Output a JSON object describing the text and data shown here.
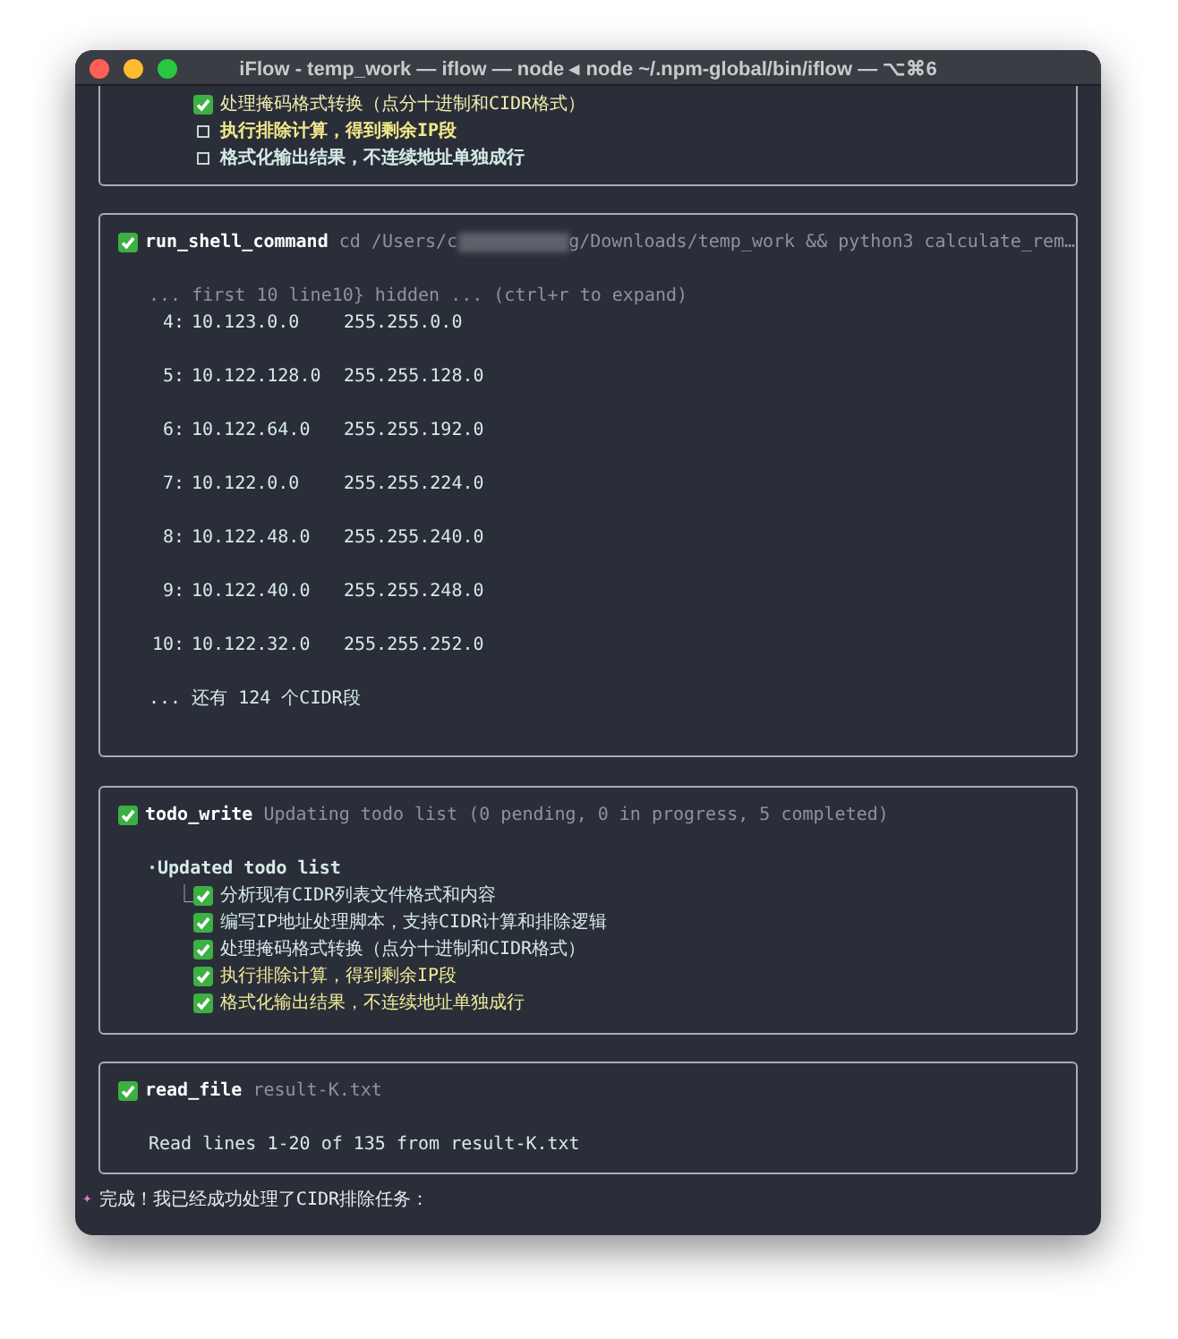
{
  "window": {
    "title": "iFlow - temp_work — iflow — node ◂ node ~/.npm-global/bin/iflow — ⌥⌘6"
  },
  "top_todo": {
    "items": [
      {
        "text": "处理掩码格式转换（点分十进制和CIDR格式）",
        "checked": true,
        "color": "#f3eeae"
      },
      {
        "text": "执行排除计算，得到剩余IP段",
        "checked": false,
        "color": "#f2e889"
      },
      {
        "text": "格式化输出结果，不连续地址单独成行",
        "checked": false,
        "color": "#d5ebe4"
      }
    ]
  },
  "shell_tool": {
    "name": "run_shell_command",
    "command_start": "cd /Users/c",
    "command_end": "g/Downloads/temp_work && python3 calculate_rem…",
    "hidden_note": "... first 10 line10} hidden ... (ctrl+r to expand)",
    "rows": [
      {
        "index": "4:",
        "ip": "10.123.0.0",
        "mask": "255.255.0.0"
      },
      {
        "index": "5:",
        "ip": "10.122.128.0",
        "mask": "255.255.128.0"
      },
      {
        "index": "6:",
        "ip": "10.122.64.0",
        "mask": "255.255.192.0"
      },
      {
        "index": "7:",
        "ip": "10.122.0.0",
        "mask": "255.255.224.0"
      },
      {
        "index": "8:",
        "ip": "10.122.48.0",
        "mask": "255.255.240.0"
      },
      {
        "index": "9:",
        "ip": "10.122.40.0",
        "mask": "255.255.248.0"
      },
      {
        "index": "10:",
        "ip": "10.122.32.0",
        "mask": "255.255.252.0"
      }
    ],
    "more": "... 还有 124 个CIDR段"
  },
  "todo_tool": {
    "name": "todo_write",
    "summary": "Updating todo list (0 pending, 0 in progress, 5 completed)",
    "heading": "·Updated todo list",
    "tree_mark": "⎿",
    "items": [
      {
        "text": "分析现有CIDR列表文件格式和内容",
        "checked": true,
        "color": "#d5ebe4"
      },
      {
        "text": "编写IP地址处理脚本，支持CIDR计算和排除逻辑",
        "checked": true,
        "color": "#d5ebe4"
      },
      {
        "text": "处理掩码格式转换（点分十进制和CIDR格式）",
        "checked": true,
        "color": "#d5ebe4"
      },
      {
        "text": "执行排除计算，得到剩余IP段",
        "checked": true,
        "color": "#f2eb98"
      },
      {
        "text": "格式化输出结果，不连续地址单独成行",
        "checked": true,
        "color": "#f2eb98"
      }
    ]
  },
  "read_tool": {
    "name": "read_file",
    "argument": "result-K.txt",
    "result": "Read lines 1-20 of 135 from result-K.txt"
  },
  "message": {
    "marker": "✦",
    "text": "完成！我已经成功处理了CIDR排除任务："
  }
}
